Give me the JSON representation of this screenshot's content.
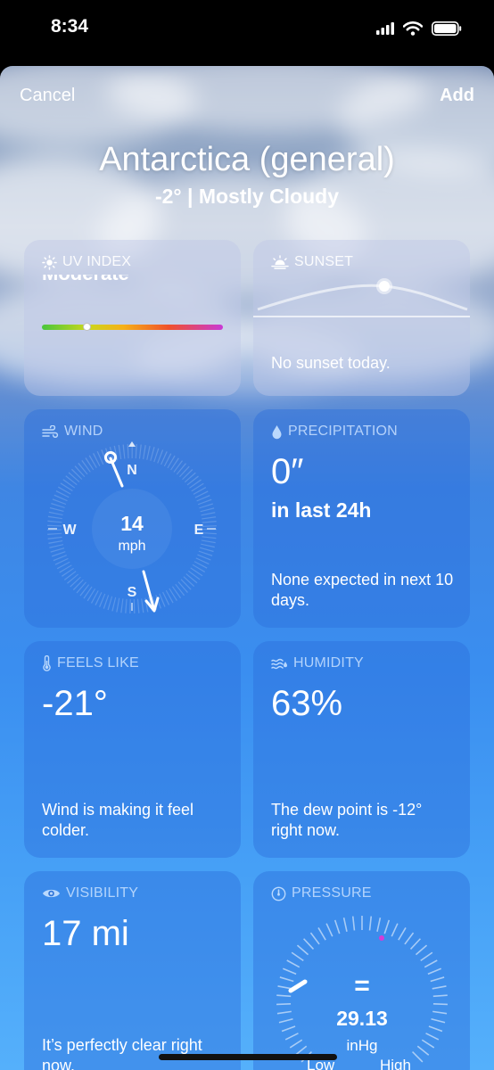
{
  "status": {
    "time": "8:34"
  },
  "nav": {
    "cancel": "Cancel",
    "add": "Add"
  },
  "location": {
    "name": "Antarctica (general)",
    "summary": "-2°  |  Mostly Cloudy"
  },
  "uv": {
    "label": "UV INDEX",
    "level_text": "Moderate",
    "level_fraction": 0.25
  },
  "sunset": {
    "label": "SUNSET",
    "text": "No sunset today."
  },
  "wind": {
    "label": "WIND",
    "speed": "14",
    "unit": "mph",
    "n": "N",
    "e": "E",
    "s": "S",
    "w": "W",
    "direction": "N"
  },
  "precipitation": {
    "label": "PRECIPITATION",
    "value": "0″",
    "period": "in last 24h",
    "note": "None expected in next 10 days."
  },
  "feels_like": {
    "label": "FEELS LIKE",
    "value": "-21°",
    "note": "Wind is making it feel colder."
  },
  "humidity": {
    "label": "HUMIDITY",
    "value": "63%",
    "note": "The dew point is -12° right now."
  },
  "visibility": {
    "label": "VISIBILITY",
    "value": "17 mi",
    "note": "It’s perfectly clear right now."
  },
  "pressure": {
    "label": "PRESSURE",
    "trend_symbol": "=",
    "value": "29.13",
    "unit": "inHg",
    "low": "Low",
    "high": "High"
  },
  "colors": {
    "accent": "#3a8ef0",
    "uv_low": "#49c63d",
    "uv_high": "#c93ad6"
  }
}
